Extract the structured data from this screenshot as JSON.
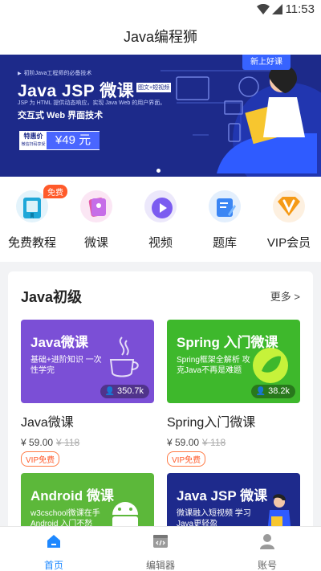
{
  "status_bar": {
    "time": "11:53"
  },
  "app_bar": {
    "title": "Java编程狮"
  },
  "banner": {
    "sub_text": "初阶Java工程师的必备技术",
    "title": "Java JSP 微课",
    "tag": "图文+短视频",
    "desc": "JSP 为 HTML 提供动态响应，实现 Java Web 的用户界面。",
    "subtitle": "交互式 Web 界面技术",
    "price_label": "特惠价",
    "price_label_small": "微信扫码享受",
    "price": "¥49 元",
    "badge": "新上好课"
  },
  "quick_nav": [
    {
      "label": "免费教程",
      "badge": "免费",
      "icon": "book-icon"
    },
    {
      "label": "微课",
      "icon": "cards-icon"
    },
    {
      "label": "视频",
      "icon": "play-icon"
    },
    {
      "label": "题库",
      "icon": "quiz-icon"
    },
    {
      "label": "VIP会员",
      "icon": "vip-icon"
    }
  ],
  "section": {
    "title": "Java初级",
    "more": "更多 >",
    "courses": [
      {
        "cover_title": "Java微课",
        "cover_desc": "基础+进阶知识 一次性学完",
        "views": "350.7k",
        "name": "Java微课",
        "price": "¥ 59.00",
        "orig_price": "¥ 118",
        "vip": "VIP免费",
        "color": "#7b4fd6"
      },
      {
        "cover_title": "Spring 入门微课",
        "cover_desc": "Spring框架全解析 攻克Java不再是难题",
        "views": "38.2k",
        "name": "Spring入门微课",
        "price": "¥ 59.00",
        "orig_price": "¥ 118",
        "vip": "VIP免费",
        "color": "#3eb82c"
      },
      {
        "cover_title": "Android 微课",
        "cover_desc": "w3cschool微课在手 Android 入门不愁",
        "color": "#5cb83a"
      },
      {
        "cover_title": "Java JSP 微课",
        "cover_desc": "微课融入短视频 学习Java更轻盈",
        "color": "#1e2a8c"
      }
    ]
  },
  "bottom_nav": [
    {
      "label": "首页",
      "icon": "home-icon",
      "active": true
    },
    {
      "label": "编辑器",
      "icon": "code-editor-icon"
    },
    {
      "label": "账号",
      "icon": "user-icon"
    }
  ]
}
